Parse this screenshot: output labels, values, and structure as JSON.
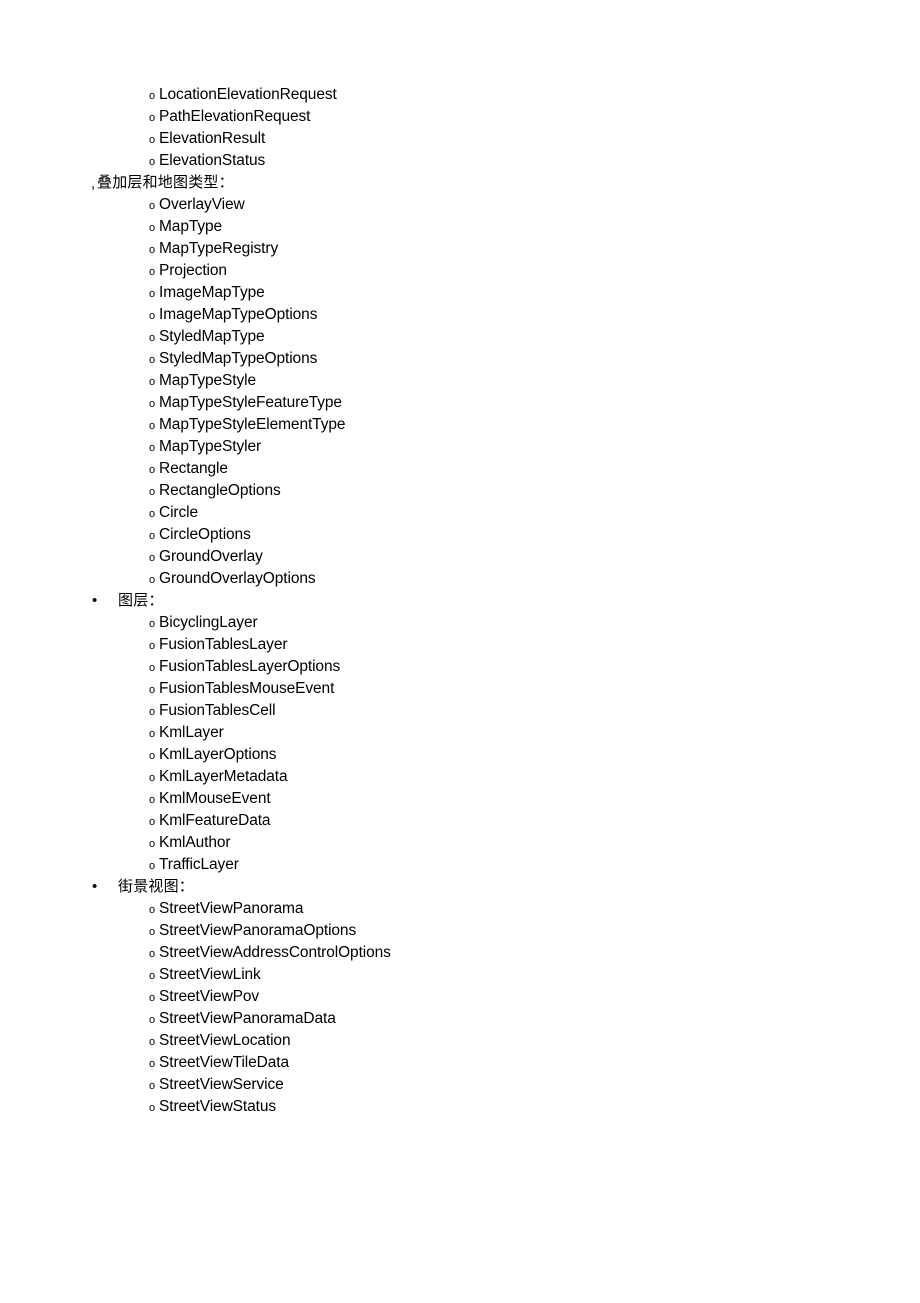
{
  "document": {
    "page_background": "#ffffff",
    "text_color": "#000000",
    "level2_marker": "o",
    "level1_marker": "•",
    "level1_marker_alt": ","
  },
  "blocks": [
    {
      "type": "entries",
      "items": [
        "LocationElevationRequest",
        "PathElevationRequest",
        "ElevationResult",
        "ElevationStatus"
      ]
    },
    {
      "type": "section",
      "marker_style": "comma",
      "heading": "叠加层和地图类型：",
      "items": [
        "OverlayView",
        "MapType",
        "MapTypeRegistry",
        "Projection",
        "ImageMapType",
        "ImageMapTypeOptions",
        "StyledMapType",
        "StyledMapTypeOptions",
        "MapTypeStyle",
        "MapTypeStyleFeatureType",
        "MapTypeStyleElementType",
        "MapTypeStyler",
        "Rectangle",
        "RectangleOptions",
        "Circle",
        "CircleOptions",
        "GroundOverlay",
        "GroundOverlayOptions"
      ]
    },
    {
      "type": "section",
      "marker_style": "dot",
      "heading": "图层：",
      "items": [
        "BicyclingLayer",
        "FusionTablesLayer",
        "FusionTablesLayerOptions",
        "FusionTablesMouseEvent",
        "FusionTablesCell",
        "KmlLayer",
        "KmlLayerOptions",
        "KmlLayerMetadata",
        "KmlMouseEvent",
        "KmlFeatureData",
        "KmlAuthor",
        "TrafficLayer"
      ]
    },
    {
      "type": "section",
      "marker_style": "dot",
      "heading": "街景视图：",
      "items": [
        "StreetViewPanorama",
        "StreetViewPanoramaOptions",
        "StreetViewAddressControlOptions",
        "StreetViewLink",
        "StreetViewPov",
        "StreetViewPanoramaData",
        "StreetViewLocation",
        "StreetViewTileData",
        "StreetViewService",
        "StreetViewStatus"
      ]
    }
  ]
}
